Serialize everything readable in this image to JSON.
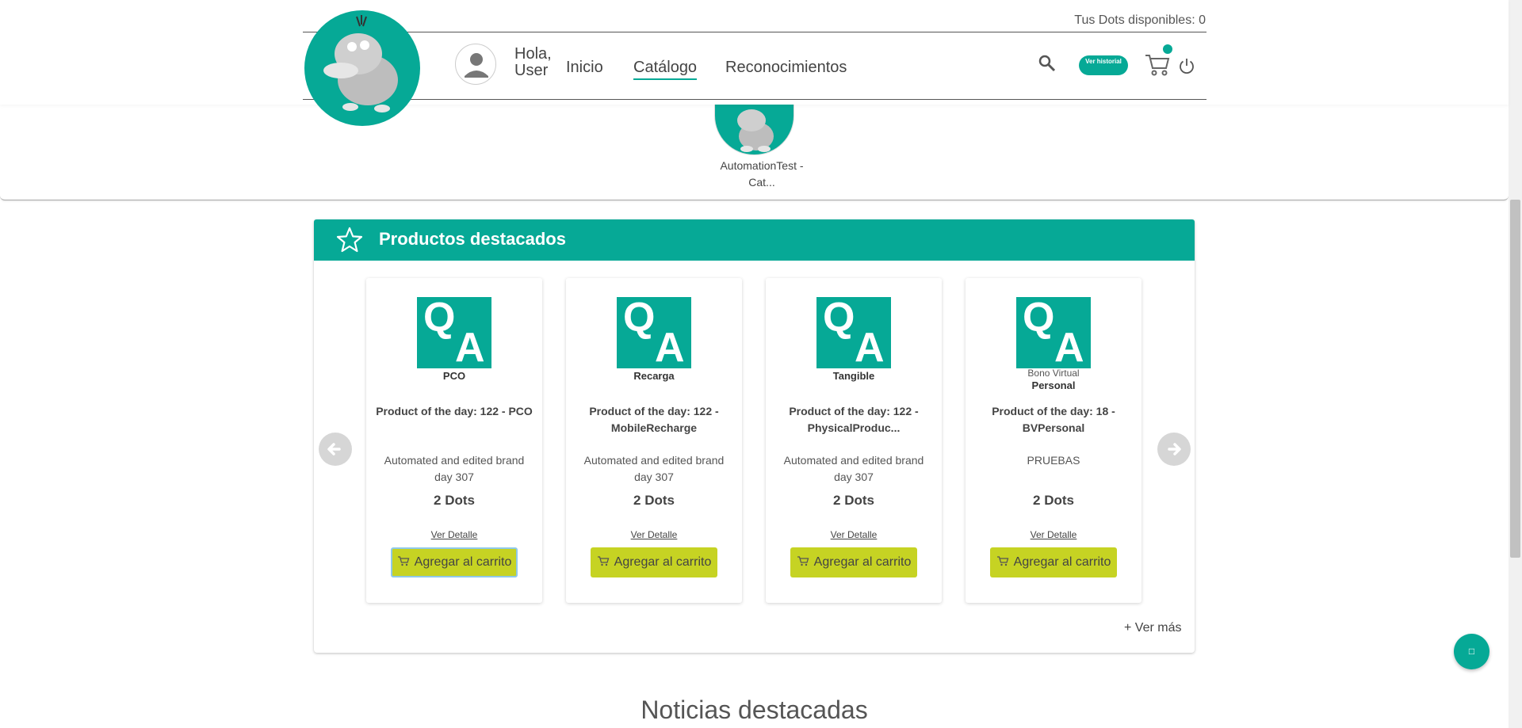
{
  "header": {
    "dots_label": "Tus Dots disponibles:",
    "dots_value": "0",
    "greeting_line1": "Hola,",
    "greeting_line2": "User",
    "nav": [
      {
        "label": "Inicio",
        "active": false
      },
      {
        "label": "Catálogo",
        "active": true
      },
      {
        "label": "Reconocimientos",
        "active": false
      }
    ],
    "history_button": "Ver historial",
    "icons": {
      "search": "search-icon",
      "cart": "cart-icon",
      "power": "power-icon",
      "avatar": "user-avatar-icon"
    }
  },
  "category": {
    "label": "AutomationTest - Cat..."
  },
  "featured": {
    "title": "Productos destacados",
    "see_more": "+ Ver más",
    "products": [
      {
        "type": "PCO",
        "subtype": "",
        "name": "Product of the day: 122 - PCO",
        "brand": "Automated and edited brand day 307",
        "price": "2 Dots",
        "detail": "Ver Detalle",
        "add": "Agregar al carrito"
      },
      {
        "type": "Recarga",
        "subtype": "",
        "name": "Product of the day: 122 - MobileRecharge",
        "brand": "Automated and edited brand day 307",
        "price": "2 Dots",
        "detail": "Ver Detalle",
        "add": "Agregar al carrito"
      },
      {
        "type": "Tangible",
        "subtype": "",
        "name": "Product of the day: 122 - PhysicalProduc...",
        "brand": "Automated and edited brand day 307",
        "price": "2 Dots",
        "detail": "Ver Detalle",
        "add": "Agregar al carrito"
      },
      {
        "type": "Personal",
        "subtype": "Bono Virtual",
        "name": "Product of the day: 18 - BVPersonal",
        "brand": "PRUEBAS",
        "price": "2 Dots",
        "detail": "Ver Detalle",
        "add": "Agregar al carrito"
      }
    ],
    "qa_letters": {
      "q": "Q",
      "a": "A"
    }
  },
  "news": {
    "title": "Noticias destacadas"
  },
  "fab": {
    "glyph": "□"
  },
  "colors": {
    "brand": "#06a996",
    "add_button": "#c6d323"
  }
}
